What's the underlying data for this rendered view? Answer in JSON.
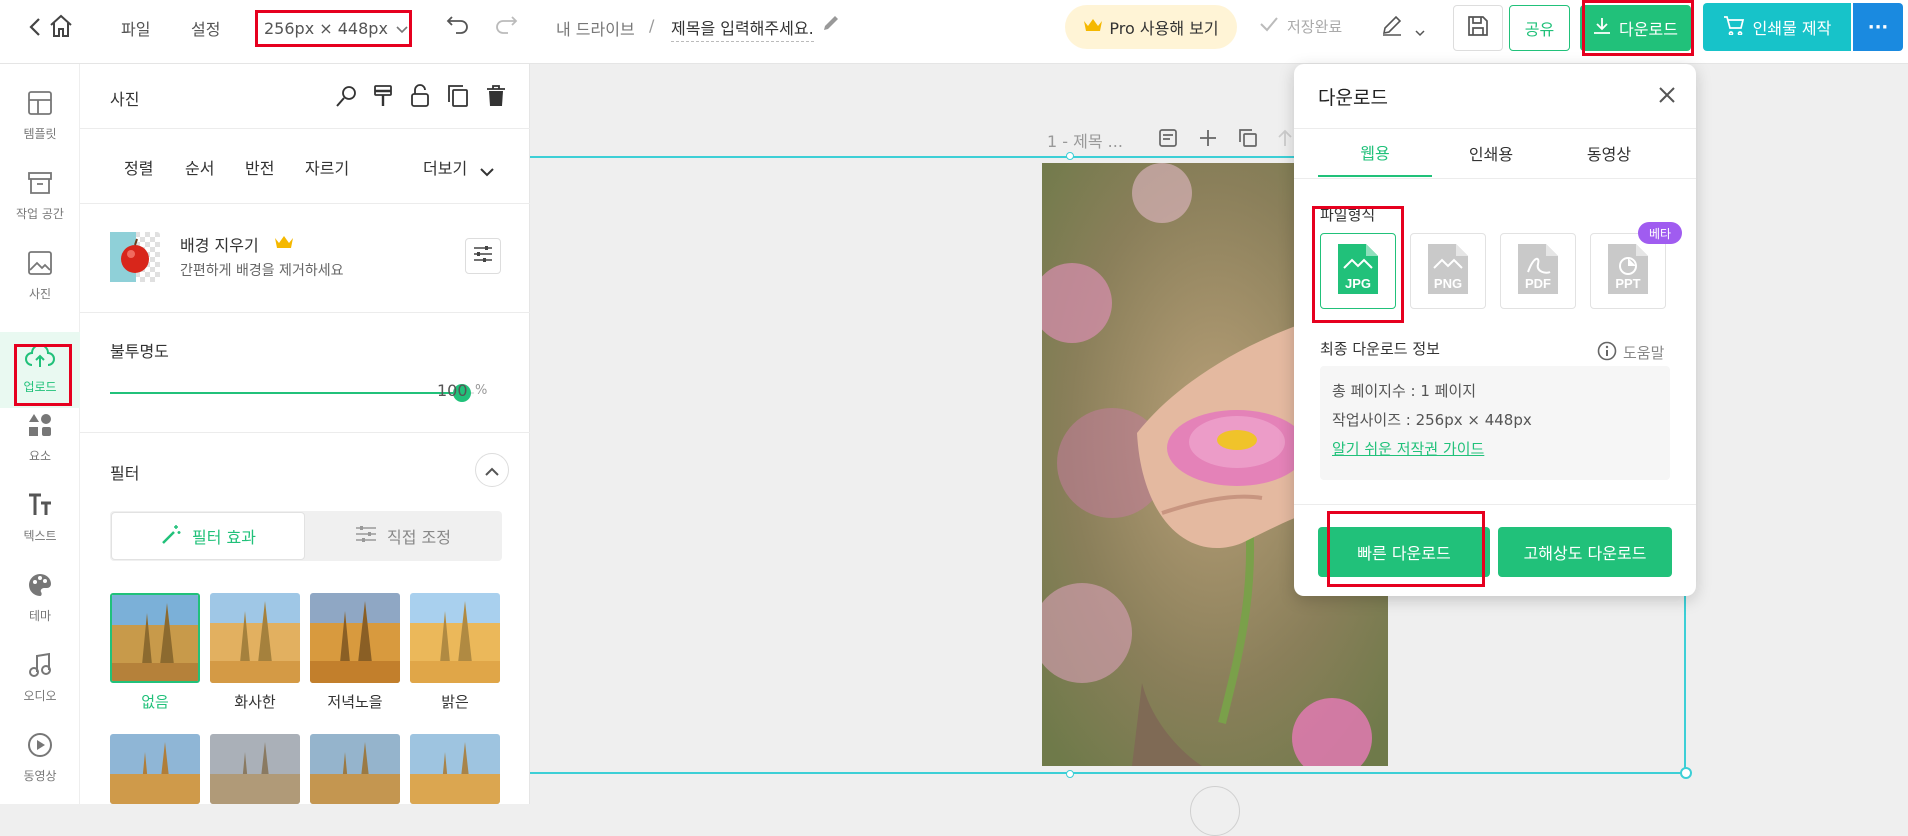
{
  "topbar": {
    "menu_file": "파일",
    "menu_settings": "설정",
    "size_label": "256px × 448px",
    "breadcrumb_root": "내 드라이브",
    "breadcrumb_sep": "/",
    "title_placeholder": "제목을 입력해주세요.",
    "pro_label": "Pro 사용해 보기",
    "save_status": "저장완료",
    "share_label": "공유",
    "download_label": "다운로드",
    "print_label": "인쇄물 제작",
    "more_label": "···"
  },
  "rail": {
    "items": [
      {
        "label": "템플릿",
        "icon": "template-icon"
      },
      {
        "label": "작업 공간",
        "icon": "workspace-icon"
      },
      {
        "label": "사진",
        "icon": "photo-icon"
      },
      {
        "label": "업로드",
        "icon": "upload-icon",
        "active": true
      },
      {
        "label": "요소",
        "icon": "elements-icon"
      },
      {
        "label": "텍스트",
        "icon": "text-icon"
      },
      {
        "label": "테마",
        "icon": "palette-icon"
      },
      {
        "label": "오디오",
        "icon": "audio-icon"
      },
      {
        "label": "동영상",
        "icon": "video-icon"
      }
    ]
  },
  "panel": {
    "title": "사진",
    "tabs": [
      "정렬",
      "순서",
      "반전",
      "자르기"
    ],
    "more": "더보기",
    "bg_remove_title": "배경 지우기",
    "bg_remove_desc": "간편하게 배경을 제거하세요",
    "opacity_label": "불투명도",
    "opacity_value": "100",
    "opacity_unit": "%",
    "opacity_level": 1.0,
    "filter_label": "필터",
    "filter_tab_effect": "필터 효과",
    "filter_tab_manual": "직접 조정",
    "filters": [
      "없음",
      "화사한",
      "저녁노을",
      "밝은"
    ]
  },
  "canvas": {
    "page_label": "1 - 제목 ..."
  },
  "download_panel": {
    "title": "다운로드",
    "tabs": [
      "웹용",
      "인쇄용",
      "동영상"
    ],
    "active_tab": "웹용",
    "file_format_label": "파일형식",
    "formats": [
      "JPG",
      "PNG",
      "PDF",
      "PPT"
    ],
    "selected_format": "JPG",
    "beta_badge": "베타",
    "info_title": "최종 다운로드 정보",
    "help_label": "도움말",
    "pages_info": "총 페이지수 : 1 페이지",
    "size_info": "작업사이즈 : 256px × 448px",
    "copyright_link": "알기 쉬운 저작권 가이드",
    "quick_download": "빠른 다운로드",
    "hd_download": "고해상도 다운로드"
  },
  "colors": {
    "accent_green": "#21c17a",
    "teal": "#17c3c9",
    "selection_cyan": "#3ccfd6",
    "pro_bg": "#fff4d6",
    "beta_purple": "#a05cf0",
    "highlight_red": "#e6001f"
  }
}
